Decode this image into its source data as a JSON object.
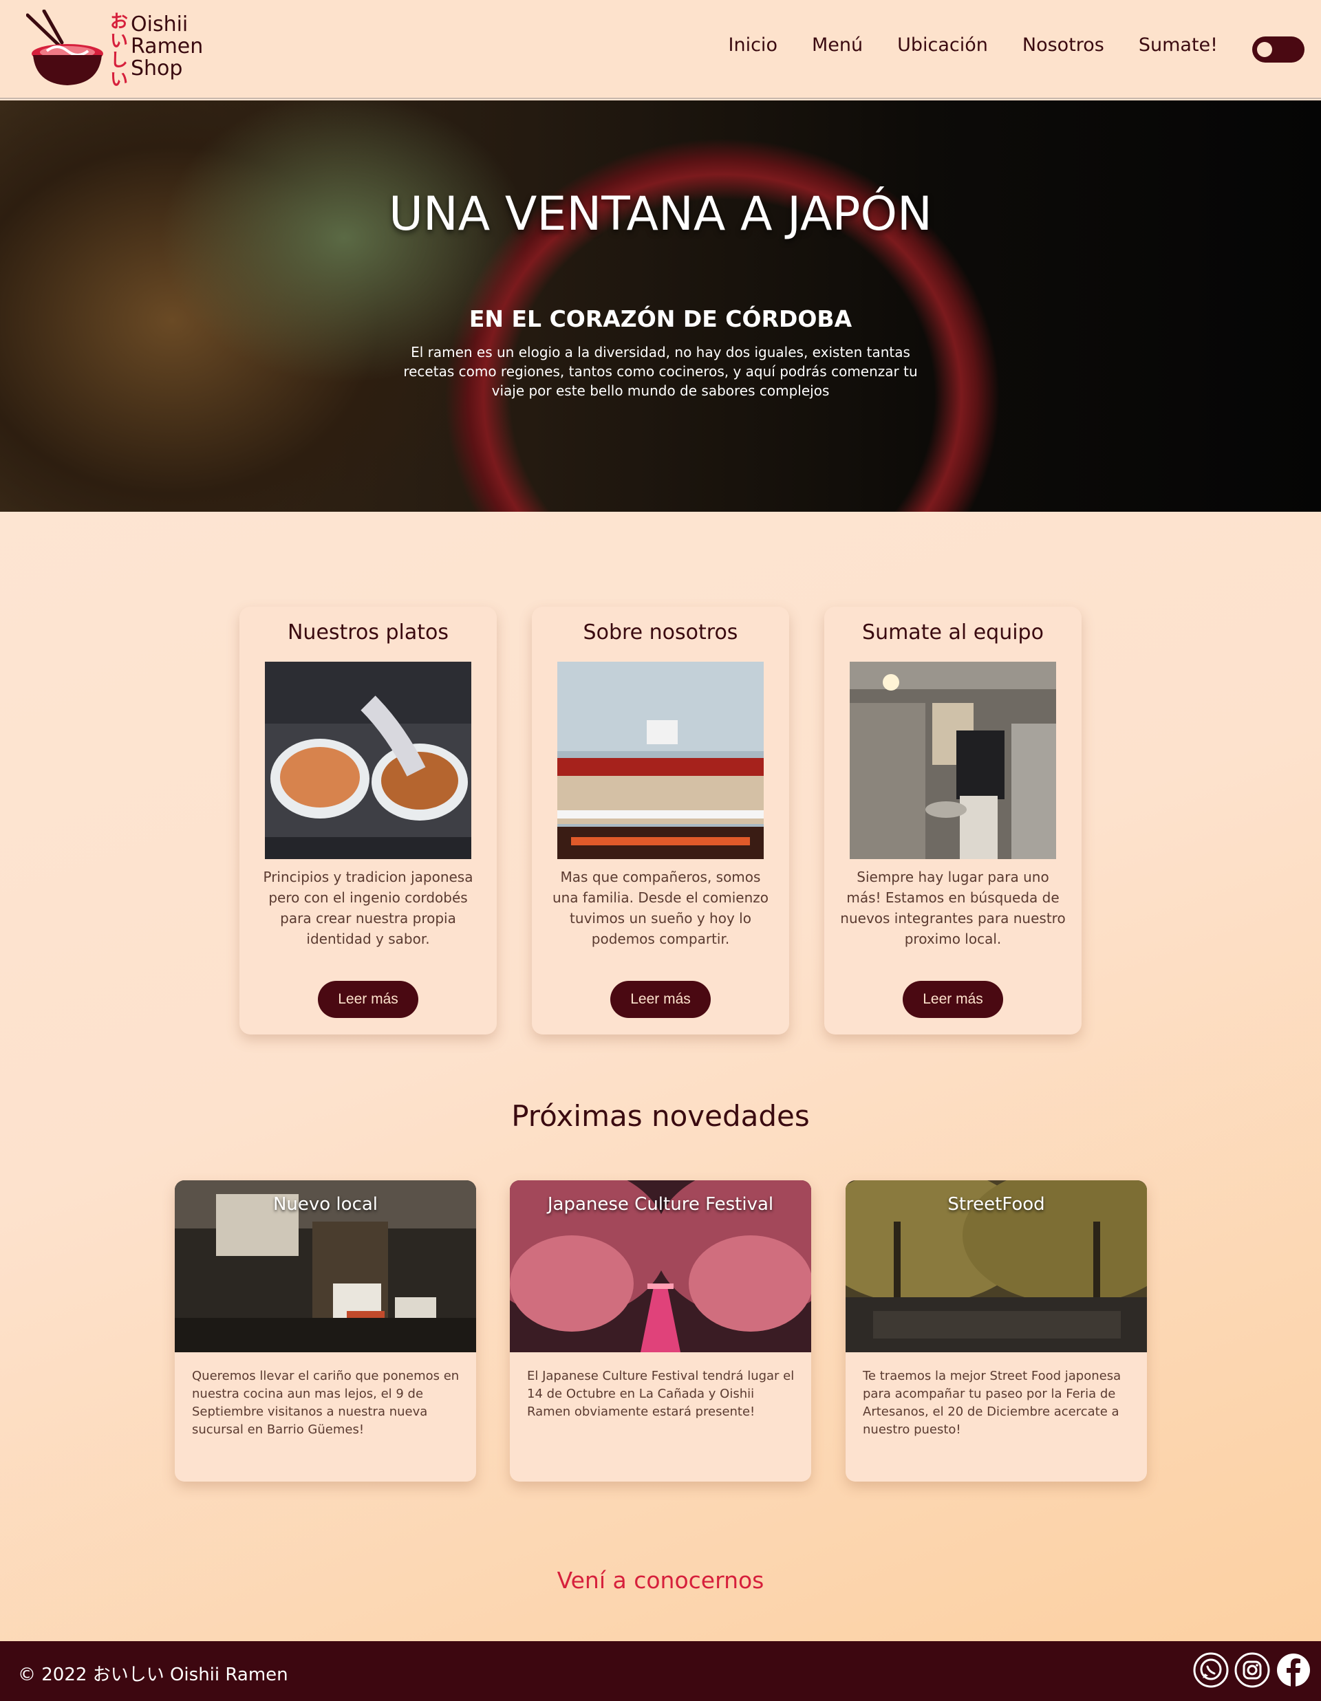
{
  "header": {
    "logo_kana": [
      "お",
      "い",
      "し",
      "い"
    ],
    "logo_name": [
      "Oishii",
      "Ramen",
      "Shop"
    ],
    "nav": [
      "Inicio",
      "Menú",
      "Ubicación",
      "Nosotros",
      "Sumate!"
    ],
    "theme_toggle": "dark-mode-toggle"
  },
  "hero": {
    "title": "UNA VENTANA A JAPÓN",
    "subtitle": "EN EL CORAZÓN DE CÓRDOBA",
    "text": "El ramen es un elogio a la diversidad, no hay dos iguales, existen tantas recetas como regiones, tantos como cocineros, y aquí podrás comenzar tu viaje por este bello mundo de sabores complejos"
  },
  "cards": [
    {
      "title": "Nuestros platos",
      "text": "Principios y tradicion japonesa pero con el ingenio cordobés para crear nuestra propia identidad y sabor.",
      "button": "Leer más"
    },
    {
      "title": "Sobre nosotros",
      "text": "Mas que compañeros, somos una familia. Desde el comienzo tuvimos un sueño y hoy lo podemos compartir.",
      "button": "Leer más"
    },
    {
      "title": "Sumate al equipo",
      "text": "Siempre hay lugar para uno más! Estamos en búsqueda de nuevos integrantes para nuestro proximo local.",
      "button": "Leer más"
    }
  ],
  "news_title": "Próximas novedades",
  "news": [
    {
      "title": "Nuevo local",
      "text": "Queremos llevar el cariño que ponemos en nuestra cocina aun mas lejos, el 9 de Septiembre visitanos a nuestra nueva sucursal en Barrio Güemes!"
    },
    {
      "title": "Japanese Culture Festival",
      "text": "El Japanese Culture Festival tendrá lugar el 14 de Octubre en La Cañada y Oishii Ramen obviamente estará presente!"
    },
    {
      "title": "StreetFood",
      "text": "Te traemos la mejor Street Food japonesa para acompañar tu paseo por la Feria de Artesanos, el 20 de Diciembre acercate a nuestro puesto!"
    }
  ],
  "cta": "Vení a conocernos",
  "footer": {
    "copyright": "© 2022 おいしい Oishii Ramen",
    "socials": [
      "whatsapp-icon",
      "instagram-icon",
      "facebook-icon"
    ]
  },
  "colors": {
    "brand_dark": "#3d0710",
    "accent_red": "#d6203c",
    "background": "#fde2cc"
  }
}
